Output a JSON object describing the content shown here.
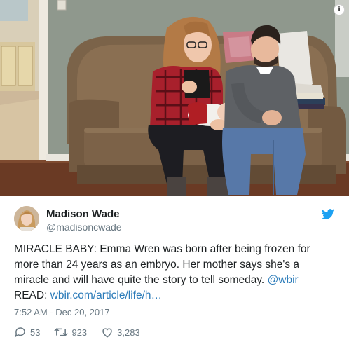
{
  "media": {
    "info_icon": "info-icon",
    "info_glyph": "i"
  },
  "tweet": {
    "author_name": "Madison Wade",
    "author_handle": "@madisoncwade",
    "avatar_icon": "avatar",
    "brand_icon": "twitter-bird-icon",
    "text_main": "MIRACLE BABY: Emma Wren was born after being frozen for more than 24 years as an embryo. Her mother says she's a miracle and will have quite the story to tell someday.",
    "mention": "@wbir",
    "read_prefix": "READ:",
    "link_text": "wbir.com/article/life/h…",
    "timestamp": "7:52 AM - Dec 20, 2017",
    "replies": "53",
    "retweets": "923",
    "likes": "3,283"
  },
  "colors": {
    "twitter_blue": "#1da1f2",
    "link": "#2b7bb9",
    "text": "#1c2022",
    "secondary": "#697882",
    "like_red": "#e0245e"
  }
}
